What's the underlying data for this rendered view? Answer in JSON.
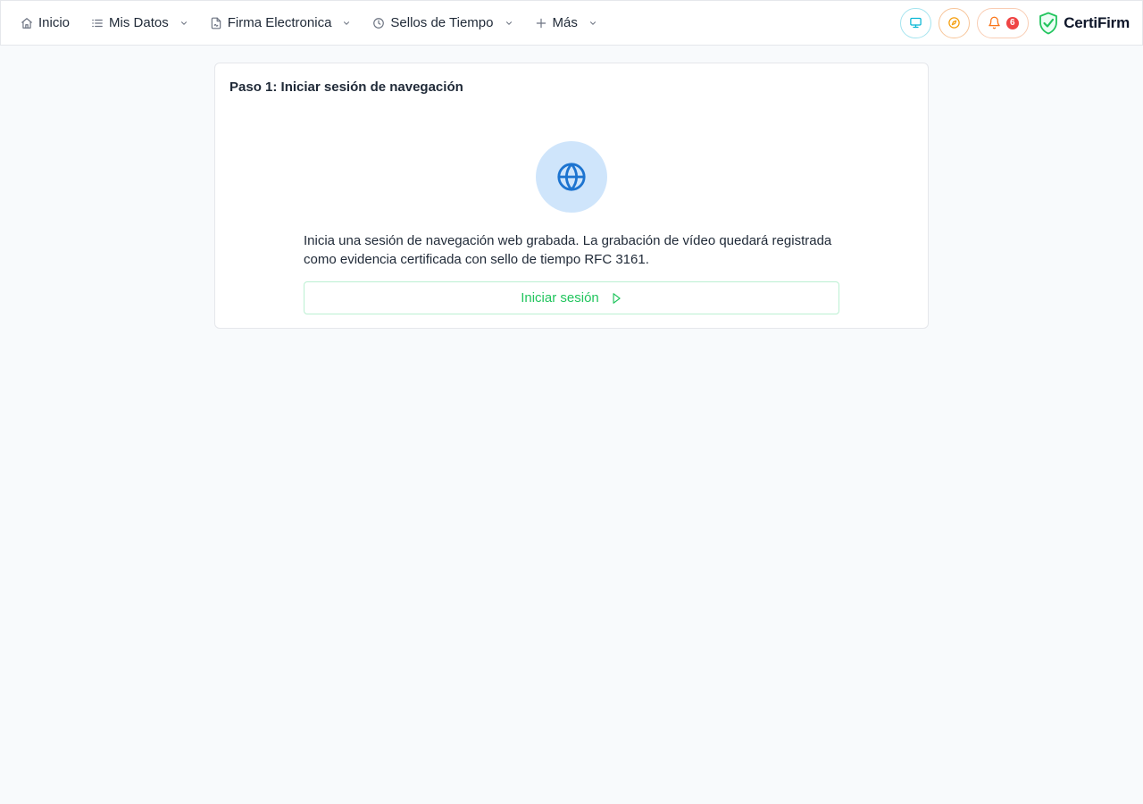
{
  "nav": {
    "items": [
      {
        "label": "Inicio",
        "icon": "home-icon",
        "dropdown": false
      },
      {
        "label": "Mis Datos",
        "icon": "list-icon",
        "dropdown": true
      },
      {
        "label": "Firma Electronica",
        "icon": "file-signature-icon",
        "dropdown": true
      },
      {
        "label": "Sellos de Tiempo",
        "icon": "clock-icon",
        "dropdown": true
      },
      {
        "label": "Más",
        "icon": "plus-icon",
        "dropdown": true
      }
    ]
  },
  "header": {
    "notifications_count": "6",
    "brand_name": "CertiFirm",
    "icons": [
      "monitor-icon",
      "compass-icon",
      "bell-icon",
      "shield-check-icon"
    ]
  },
  "card": {
    "title": "Paso 1: Iniciar sesión de navegación",
    "icon": "globe-icon",
    "description": "Inicia una sesión de navegación web grabada. La grabación de vídeo quedará registrada como evidencia certificada con sello de tiempo RFC 3161.",
    "button_label": "Iniciar sesión",
    "button_icon": "play-icon"
  },
  "colors": {
    "accent_green": "#22c55e",
    "globe_blue": "#1d74d0",
    "globe_bg": "#cfe5fb",
    "monitor_cyan": "#06b6d4",
    "compass_orange": "#f59e0b",
    "bell_orange": "#f97316",
    "badge_red": "#ef4444"
  }
}
